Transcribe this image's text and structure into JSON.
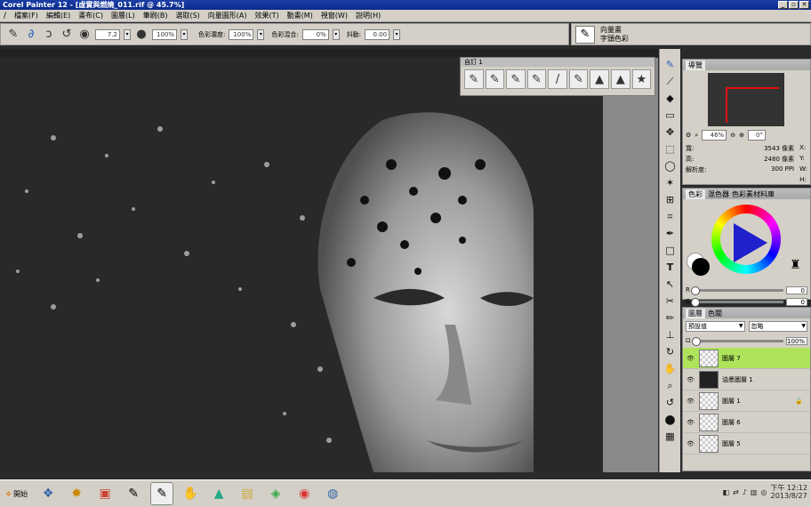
{
  "window": {
    "title": "Corel Painter 12 - [虛實與燃燒_011.rif @ 45.7%]"
  },
  "menu": [
    "檔案(F)",
    "編輯(E)",
    "畫布(C)",
    "圖層(L)",
    "筆刷(B)",
    "選取(S)",
    "向量圖形(A)",
    "效果(T)",
    "動畫(M)",
    "視窗(W)",
    "說明(H)"
  ],
  "propbar": {
    "size_value": "7.2",
    "opacity_value": "100%",
    "color_density_label": "色彩濃度:",
    "color_density_value": "100%",
    "color_mix_label": "色彩混合:",
    "color_mix_value": "0%",
    "jitter_label": "抖動:",
    "jitter_value": "0.00"
  },
  "brush_selector": {
    "category": "向量畫",
    "variant": "字頭色彩"
  },
  "custom_palette": {
    "title": "自訂 1"
  },
  "navigator": {
    "tab": "導覽",
    "zoom": "46%",
    "rotation": "0°",
    "width_label": "寬:",
    "width_value": "3543 像素",
    "height_label": "高:",
    "height_value": "2480 像素",
    "resolution_label": "解析度:",
    "resolution_value": "300 PPI",
    "x_label": "X:",
    "y_label": "Y:",
    "w_label": "W:",
    "h_label": "H:"
  },
  "color_panel": {
    "tabs": [
      "色彩",
      "混色器",
      "色彩素材料庫"
    ],
    "r_label": "R",
    "r_value": "0",
    "g_label": "G",
    "g_value": "0"
  },
  "layers_panel": {
    "tabs": [
      "圖層",
      "色關"
    ],
    "preset": "預設值",
    "composite": "忽略",
    "opacity": "100%",
    "layers": [
      {
        "name": "圖層 7",
        "active": true
      },
      {
        "name": "油墨圖層 1",
        "active": false
      },
      {
        "name": "圖層 1",
        "active": false
      },
      {
        "name": "圖層 6",
        "active": false
      },
      {
        "name": "圖層 5",
        "active": false
      }
    ]
  },
  "taskbar": {
    "start_label": "開始",
    "time": "下午 12:12",
    "date": "2013/8/27"
  },
  "colors": {
    "accent_active_layer": "#aee35a",
    "title_blue": "#0a2a8c",
    "nav_rect": "#e01010"
  }
}
